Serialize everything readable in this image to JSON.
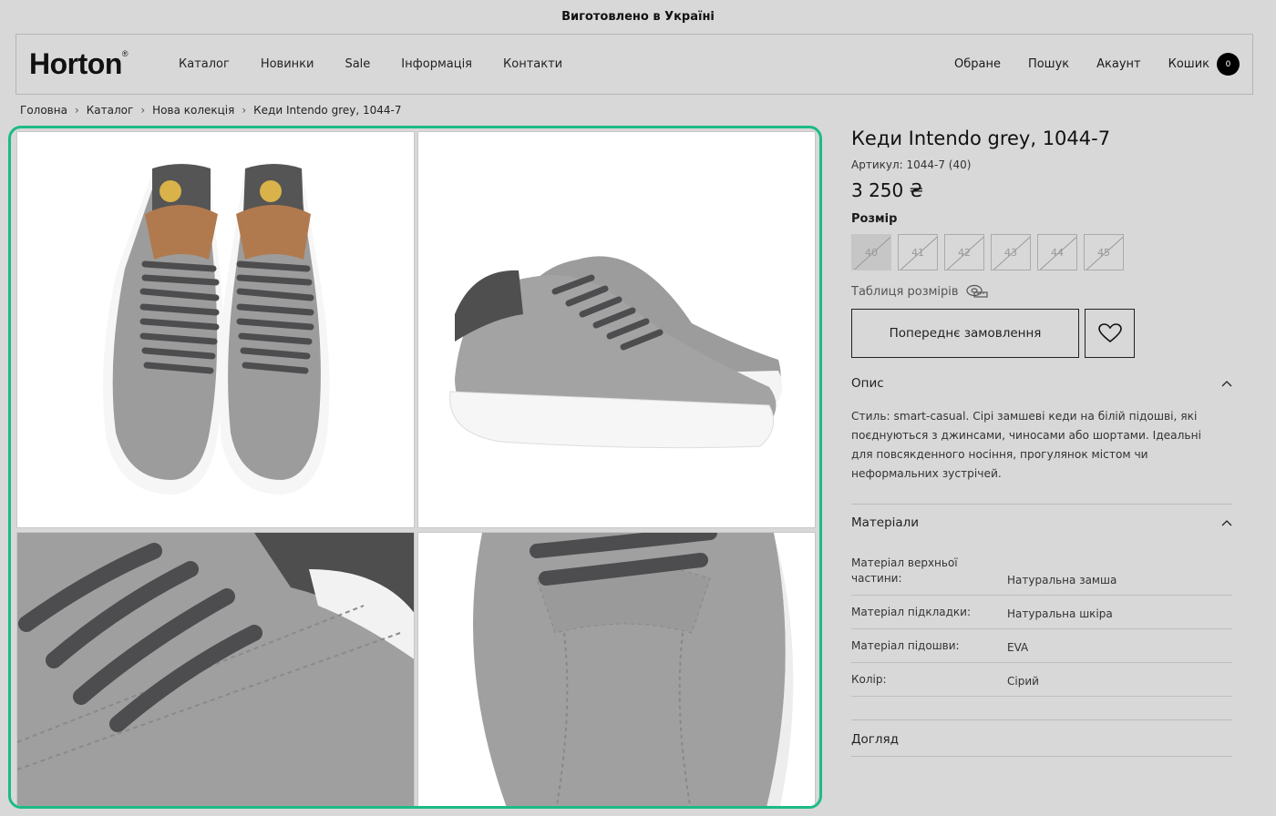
{
  "topbar": {
    "text": "Виготовлено в Україні"
  },
  "header": {
    "logo": "Horton",
    "logo_mark": "®",
    "nav": [
      "Каталог",
      "Новинки",
      "Sale",
      "Інформація",
      "Контакти"
    ],
    "actions": {
      "favorites": "Обране",
      "search": "Пошук",
      "account": "Акаунт",
      "cart": "Кошик",
      "cart_count": "0"
    }
  },
  "breadcrumbs": [
    "Головна",
    "Каталог",
    "Нова колекція",
    "Кеди Intendo grey, 1044-7"
  ],
  "breadcrumb_sep": "›",
  "product": {
    "title": "Кеди Intendo grey, 1044-7",
    "sku": "Артикул: 1044-7 (40)",
    "price": "3 250 ₴",
    "size_label": "Розмір",
    "sizes": [
      "40",
      "41",
      "42",
      "43",
      "44",
      "45"
    ],
    "selected_size": "40",
    "size_table": "Таблиця розмірів",
    "preorder": "Попереднє замовлення",
    "description_title": "Опис",
    "description": "Стиль: smart-casual. Сірі замшеві кеди на білій підошві, які поєднуються з джинсами, чиносами або шортами. Ідеальні для повсякденного носіння, прогулянок містом чи неформальних зустрічей.",
    "materials_title": "Матеріали",
    "materials": [
      {
        "k": "Матеріал верхньої частини:",
        "v": "Натуральна замша"
      },
      {
        "k": "Матеріал підкладки:",
        "v": "Натуральна шкіра"
      },
      {
        "k": "Матеріал підошви:",
        "v": "EVA"
      },
      {
        "k": "Колір:",
        "v": "Сірий"
      }
    ],
    "care_title": "Догляд"
  },
  "colors": {
    "accent": "#1dbb84",
    "suede": "#9a9a9a",
    "lace": "#4d4d4f",
    "sole": "#f4f4f4"
  }
}
